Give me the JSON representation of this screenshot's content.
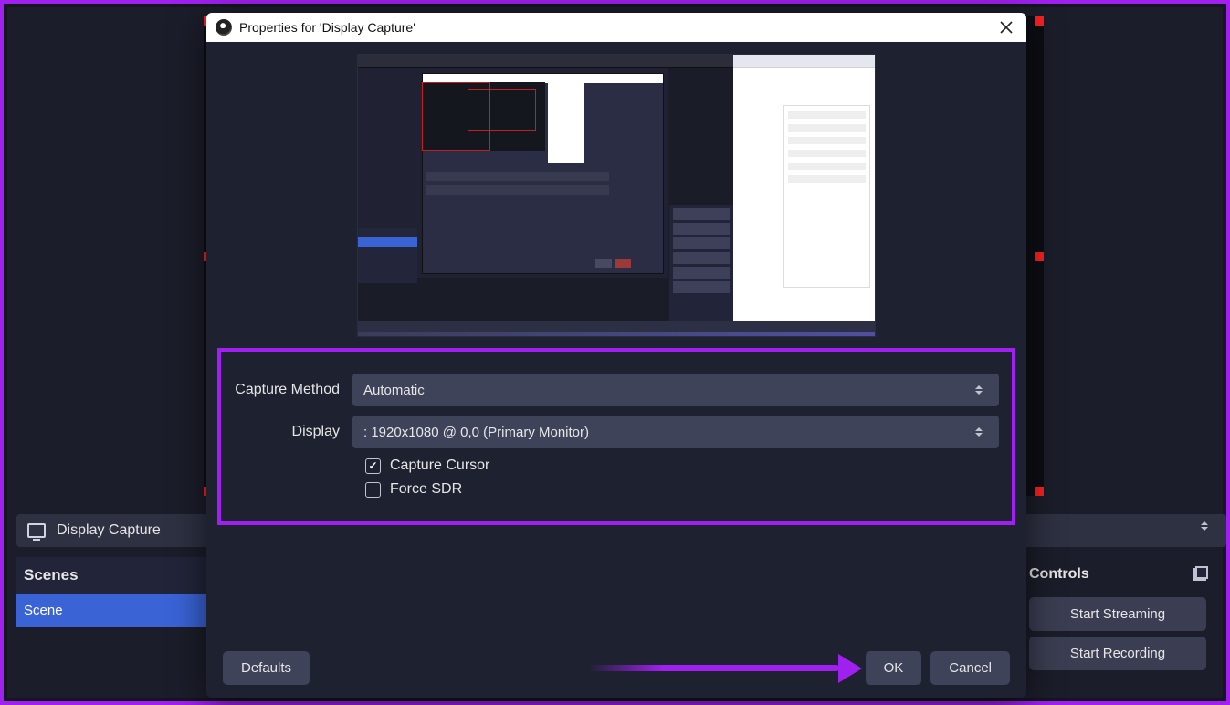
{
  "dialog": {
    "title": "Properties for 'Display Capture'",
    "capture_method_label": "Capture Method",
    "capture_method_value": "Automatic",
    "display_label": "Display",
    "display_value": ": 1920x1080 @ 0,0 (Primary Monitor)",
    "capture_cursor_label": "Capture Cursor",
    "capture_cursor_checked": true,
    "force_sdr_label": "Force SDR",
    "force_sdr_checked": false,
    "defaults_button": "Defaults",
    "ok_button": "OK",
    "cancel_button": "Cancel"
  },
  "background": {
    "source_label": "Display Capture",
    "scenes_title": "Scenes",
    "scene_item": "Scene",
    "controls_title": "Controls",
    "start_streaming": "Start Streaming",
    "start_recording": "Start Recording"
  },
  "colors": {
    "highlight": "#a020f0",
    "selection": "#3a63d6",
    "handle": "#ff2020"
  }
}
